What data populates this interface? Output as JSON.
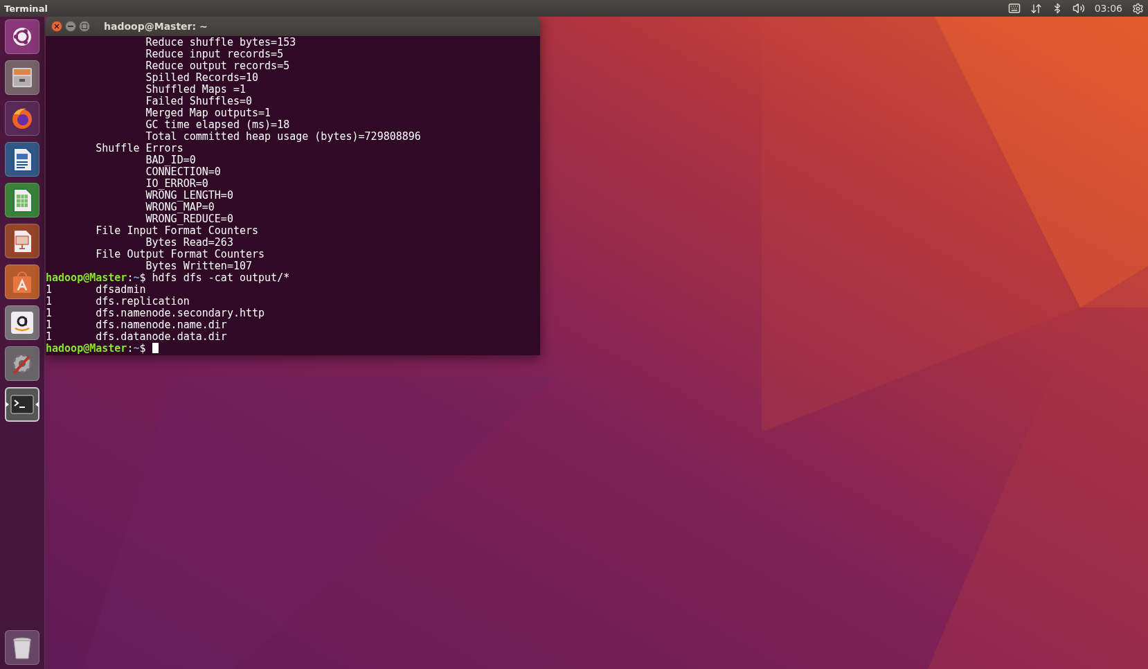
{
  "top_bar": {
    "app_name": "Terminal",
    "clock": "03:06"
  },
  "launcher": {
    "items": [
      {
        "kind": "ubuntu",
        "selected": false
      },
      {
        "kind": "files",
        "selected": false
      },
      {
        "kind": "firefox",
        "selected": false
      },
      {
        "kind": "writer",
        "selected": false
      },
      {
        "kind": "calc",
        "selected": false
      },
      {
        "kind": "impress",
        "selected": false
      },
      {
        "kind": "software",
        "selected": false
      },
      {
        "kind": "amazon",
        "selected": false
      },
      {
        "kind": "settings",
        "selected": false
      },
      {
        "kind": "terminal",
        "selected": true
      }
    ],
    "trash": {
      "kind": "trash",
      "selected": false
    }
  },
  "window": {
    "title": "hadoop@Master: ~",
    "lines": [
      {
        "kind": "text",
        "text": "                Reduce shuffle bytes=153"
      },
      {
        "kind": "text",
        "text": "                Reduce input records=5"
      },
      {
        "kind": "text",
        "text": "                Reduce output records=5"
      },
      {
        "kind": "text",
        "text": "                Spilled Records=10"
      },
      {
        "kind": "text",
        "text": "                Shuffled Maps =1"
      },
      {
        "kind": "text",
        "text": "                Failed Shuffles=0"
      },
      {
        "kind": "text",
        "text": "                Merged Map outputs=1"
      },
      {
        "kind": "text",
        "text": "                GC time elapsed (ms)=18"
      },
      {
        "kind": "text",
        "text": "                Total committed heap usage (bytes)=729808896"
      },
      {
        "kind": "text",
        "text": "        Shuffle Errors"
      },
      {
        "kind": "text",
        "text": "                BAD_ID=0"
      },
      {
        "kind": "text",
        "text": "                CONNECTION=0"
      },
      {
        "kind": "text",
        "text": "                IO_ERROR=0"
      },
      {
        "kind": "text",
        "text": "                WRONG_LENGTH=0"
      },
      {
        "kind": "text",
        "text": "                WRONG_MAP=0"
      },
      {
        "kind": "text",
        "text": "                WRONG_REDUCE=0"
      },
      {
        "kind": "text",
        "text": "        File Input Format Counters"
      },
      {
        "kind": "text",
        "text": "                Bytes Read=263"
      },
      {
        "kind": "text",
        "text": "        File Output Format Counters"
      },
      {
        "kind": "text",
        "text": "                Bytes Written=107"
      },
      {
        "kind": "prompt",
        "user_host": "hadoop@Master",
        "separator": ":",
        "path": "~",
        "symbol": "$",
        "command": "hdfs dfs -cat output/*",
        "cursor": false
      },
      {
        "kind": "text",
        "text": "1       dfsadmin"
      },
      {
        "kind": "text",
        "text": "1       dfs.replication"
      },
      {
        "kind": "text",
        "text": "1       dfs.namenode.secondary.http"
      },
      {
        "kind": "text",
        "text": "1       dfs.namenode.name.dir"
      },
      {
        "kind": "text",
        "text": "1       dfs.datanode.data.dir"
      },
      {
        "kind": "prompt",
        "user_host": "hadoop@Master",
        "separator": ":",
        "path": "~",
        "symbol": "$",
        "cursor": true
      }
    ]
  }
}
